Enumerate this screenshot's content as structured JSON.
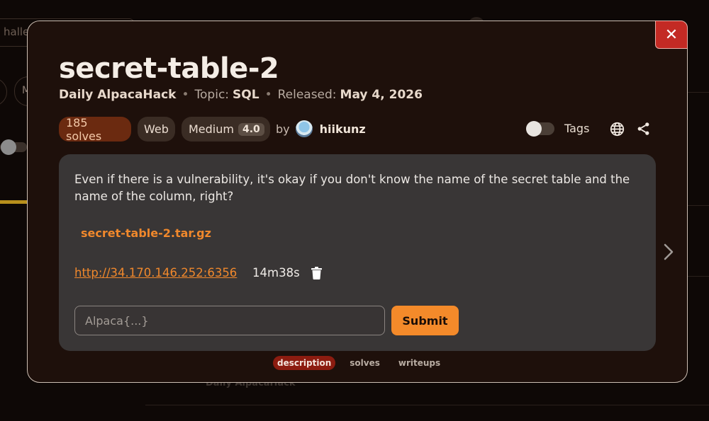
{
  "background": {
    "search_text": "haller",
    "pill_text": "M",
    "footer_text": "Daily AlpacaHack"
  },
  "modal": {
    "close_label": "✕",
    "title": "secret-table-2",
    "meta": {
      "source": "Daily AlpacaHack",
      "topic_label": "Topic:",
      "topic": "SQL",
      "released_label": "Released:",
      "released": "May 4, 2026"
    },
    "badges": {
      "solves": "185 solves",
      "category": "Web",
      "difficulty": "Medium",
      "difficulty_score": "4.0"
    },
    "author": {
      "by": "by",
      "name": "hiikunz"
    },
    "tags_label": "Tags",
    "description": "Even if there is a vulnerability, it's okay if you don't know the name of the secret table and the name of the column, right?",
    "file": "secret-table-2.tar.gz",
    "instance": {
      "url": "http://34.170.146.252:6356",
      "timer": "14m38s"
    },
    "flag_input": {
      "placeholder": "Alpaca{...}",
      "value": ""
    },
    "submit_label": "Submit",
    "tabs": [
      {
        "label": "description",
        "active": true
      },
      {
        "label": "solves",
        "active": false
      },
      {
        "label": "writeups",
        "active": false
      }
    ]
  },
  "colors": {
    "accent": "#f48a2a",
    "close": "#c32a24",
    "active_tab": "#8c1c10"
  }
}
